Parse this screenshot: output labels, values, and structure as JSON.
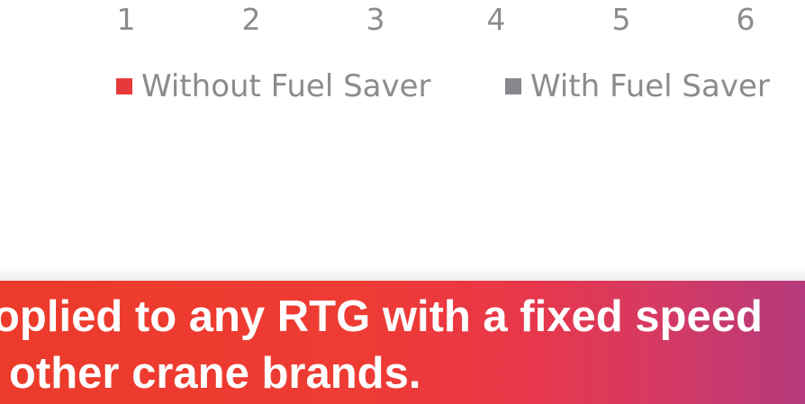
{
  "chart": {
    "x_ticks": [
      "1",
      "2",
      "3",
      "4",
      "5",
      "6"
    ],
    "legend": [
      {
        "label": "Without Fuel Saver",
        "color": "#e63a3a"
      },
      {
        "label": "With Fuel Saver",
        "color": "#86888b"
      }
    ]
  },
  "banner": {
    "line1": "oplied to any RTG with a fixed speed",
    "line2": "other crane brands."
  },
  "colors": {
    "banner_start": "#ec3b2b",
    "banner_end": "#b53a7c",
    "axis_text": "#8a8c8f"
  }
}
